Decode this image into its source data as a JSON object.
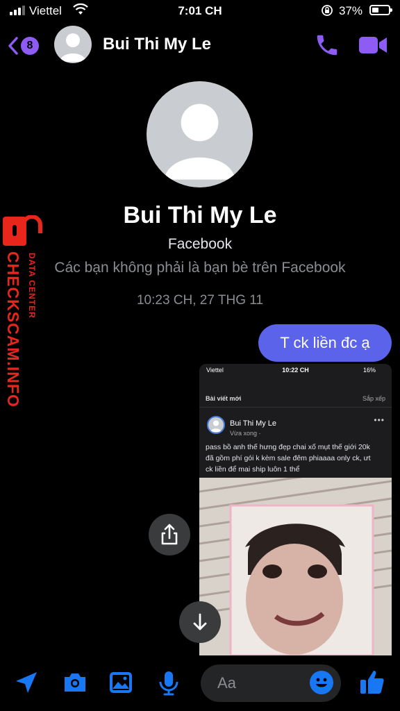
{
  "status_bar": {
    "carrier": "Viettel",
    "time": "7:01 CH",
    "battery_pct": "37%",
    "battery_level": 0.37
  },
  "header": {
    "back_badge": "8",
    "name": "Bui Thi My Le"
  },
  "profile": {
    "name": "Bui Thi My Le",
    "source": "Facebook",
    "relationship": "Các bạn không phải là bạn bè trên Facebook"
  },
  "messages": {
    "timestamp": "10:23 CH, 27 THG 11",
    "sent_text": "T ck liền đc ạ"
  },
  "watermark": {
    "brand": "CHECKSCAM.INFO",
    "sub": "DATA CENTER"
  },
  "screenshot": {
    "carrier": "Viettel",
    "time": "10:22 CH",
    "battery": "16%",
    "section_title": "Bài viết mới",
    "sort_label": "Sắp xếp",
    "post_author": "Bui Thi My Le",
    "post_time": "Vừa xong ·",
    "post_text": "pass bồ anh thế hưng đẹp chai xố mụt thế giới 20k đã gồm phí gói k kèm sale đêm phiaaaa only ck, ưt ck liền để mai ship luôn 1 thể"
  },
  "composer": {
    "placeholder": "Aa"
  },
  "colors": {
    "accent": "#8e5cf5",
    "bubble": "#5b63ea",
    "blue_icons": "#1877f2",
    "watermark": "#e8261c"
  }
}
